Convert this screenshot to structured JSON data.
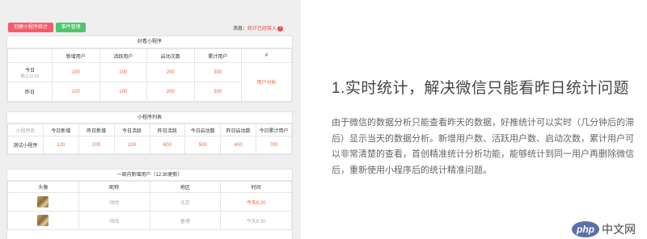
{
  "toolbar": {
    "create_label": "创建小程序统计",
    "events_label": "事件管理"
  },
  "notice": {
    "prefix": "消息：",
    "link": "统计已经接入",
    "badge": "?"
  },
  "favorites": {
    "title": "好看小程序",
    "headers": [
      "",
      "新增用户",
      "活跃用户",
      "启动次数",
      "累计用户",
      "#"
    ],
    "rows": [
      {
        "label": "今日",
        "sub": "截止12:30",
        "values": [
          "100",
          "100",
          "200",
          "300"
        ]
      },
      {
        "label": "昨日",
        "sub": "",
        "values": [
          "100",
          "100",
          "200",
          "300"
        ]
      }
    ],
    "action": "用户分析"
  },
  "list": {
    "title": "小程序列表",
    "headers": [
      "小程序名",
      "今日新增",
      "昨日新增",
      "今日活跃",
      "昨日活跃",
      "今日启动数",
      "昨日启动数",
      "今日累计用户"
    ],
    "rows": [
      {
        "name": "测试小程序",
        "values": [
          "120",
          "200",
          "100",
          "600",
          "500",
          "400",
          "700"
        ]
      }
    ]
  },
  "weekly": {
    "title": "一周内新增用户（12:30更新）",
    "headers": [
      "头像",
      "昵称",
      "地区",
      "时间"
    ],
    "rows": [
      {
        "nick": "咕咕",
        "region": "北京",
        "time": "今天8:20"
      },
      {
        "nick": "咕咕",
        "region": "香港",
        "time": "今天8:30"
      }
    ]
  },
  "article": {
    "heading": "1.实时统计，解决微信只能看昨日统计问题",
    "body": "由于微信的数据分析只能查看昨天的数据，好推统计可以实时（几分钟后的滞后）显示当天的数据分析。新增用户数、活跃用户数、启动次数，累计用户可以非常清楚的查看，首创精准统计分析功能，能够统计到同一用户再删除微信后，重新使用小程序后的统计精准问题。"
  },
  "logo": {
    "mark": "php",
    "text": "中文网"
  },
  "colors": {
    "accent_red": "#f55b6b",
    "accent_green": "#4fc56a",
    "value_orange": "#f0663a"
  }
}
